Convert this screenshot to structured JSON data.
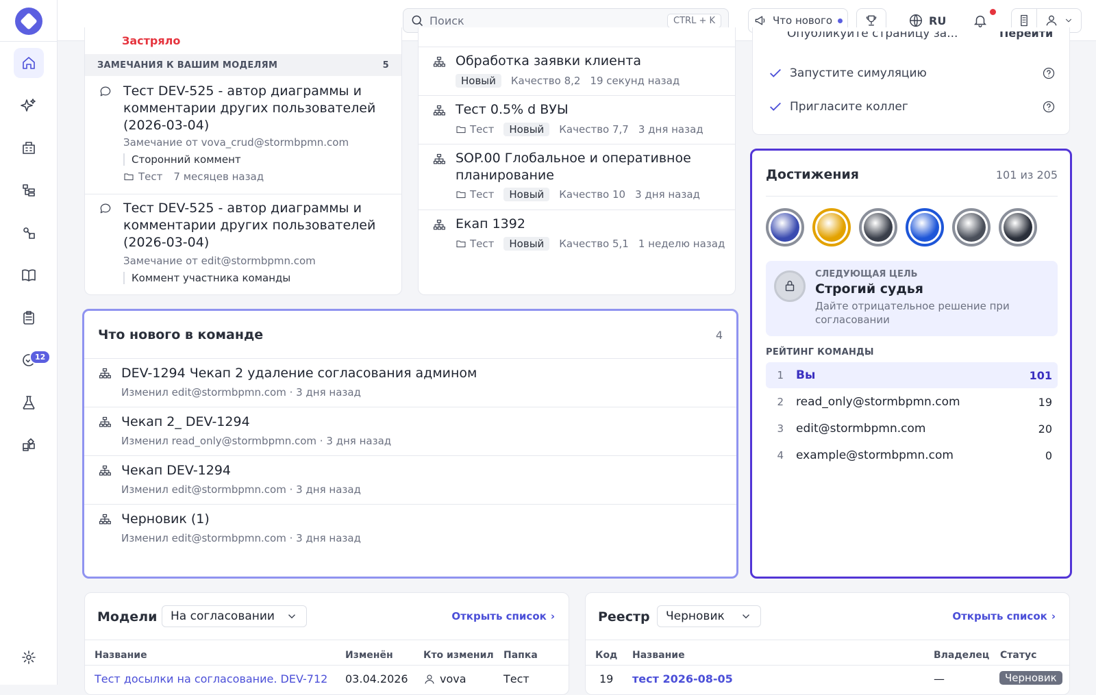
{
  "topbar": {
    "search_placeholder": "Поиск",
    "search_shortcut": "CTRL + K",
    "whats_new_label": "Что нового",
    "language": "RU"
  },
  "sidebar": {
    "badge_count": "12",
    "items": [
      "home-icon",
      "sparkles-icon",
      "building-icon",
      "hierarchy-icon",
      "shapes-icon",
      "book-icon",
      "clipboard-icon",
      "check-badge-icon",
      "flask-icon",
      "puzzle-icon"
    ]
  },
  "remarks": {
    "stuck_label": "Застряло",
    "header": "ЗАМЕЧАНИЯ К ВАШИМ МОДЕЛЯМ",
    "count": "5",
    "items": [
      {
        "title": "Тест DEV-525 - автор диаграммы и комментарии других пользователей (2026-03-04)",
        "from": "Замечание от vova_crud@stormbpmn.com",
        "quote": "Сторонний коммент",
        "folder": "Тест",
        "time": "7 месяцев назад"
      },
      {
        "title": "Тест DEV-525 - автор диаграммы и комментарии других пользователей (2026-03-04)",
        "from": "Замечание от edit@stormbpmn.com",
        "quote": "Коммент участника команды",
        "folder": "Тест",
        "time": "7 месяцев назад"
      }
    ]
  },
  "models_feed": {
    "items": [
      {
        "title": "Обработка заявки клиента",
        "folder": "",
        "status": "Новый",
        "quality": "Качество 8,2",
        "time": "19 секунд назад"
      },
      {
        "title": "Тест 0.5% d ВУЫ",
        "folder": "Тест",
        "status": "Новый",
        "quality": "Качество 7,7",
        "time": "3 дня назад"
      },
      {
        "title": "SOP.00 Глобальное и оперативное планирование",
        "folder": "Тест",
        "status": "Новый",
        "quality": "Качество 10",
        "time": "3 дня назад"
      },
      {
        "title": "Екап 1392",
        "folder": "Тест",
        "status": "Новый",
        "quality": "Качество 5,1",
        "time": "1 неделю назад"
      }
    ]
  },
  "onboarding": {
    "partial_item": "Опубликуйте страницу за...",
    "partial_action": "Перейти",
    "items": [
      "Запустите симуляцию",
      "Пригласите коллег"
    ]
  },
  "team_news": {
    "title": "Что нового в команде",
    "count": "4",
    "items": [
      {
        "title": "DEV-1294 Чекап 2 удаление согласования админом",
        "meta": "Изменил edit@stormbpmn.com · 3 дня назад"
      },
      {
        "title": "Чекап 2_ DEV-1294",
        "meta": "Изменил read_only@stormbpmn.com · 3 дня назад"
      },
      {
        "title": "Чекап DEV-1294",
        "meta": "Изменил edit@stormbpmn.com · 3 дня назад"
      },
      {
        "title": "Черновик (1)",
        "meta": "Изменил edit@stormbpmn.com · 3 дня назад"
      }
    ]
  },
  "achievements": {
    "title": "Достижения",
    "progress": "101 из 205",
    "next_goal_label": "СЛЕДУЮЩАЯ ЦЕЛЬ",
    "next_goal_title": "Строгий судья",
    "next_goal_desc": "Дайте отрицательное решение при согласовании",
    "rating_label": "РЕЙТИНГ КОМАНДЫ",
    "rating": [
      {
        "rank": "1",
        "name": "Вы",
        "score": "101"
      },
      {
        "rank": "2",
        "name": "read_only@stormbpmn.com",
        "score": "19"
      },
      {
        "rank": "3",
        "name": "edit@stormbpmn.com",
        "score": "20"
      },
      {
        "rank": "4",
        "name": "example@stormbpmn.com",
        "score": "0"
      }
    ],
    "badge_colors": [
      "#3a4bb0",
      "#e3a200",
      "#3a3f4a",
      "#1e56d8",
      "#4a4f5a",
      "#2a2f3a"
    ]
  },
  "models_table": {
    "title": "Модели",
    "filter": "На согласовании",
    "open_list": "Открыть список",
    "headers": [
      "Название",
      "Изменён",
      "Кто изменил",
      "Папка"
    ],
    "rows": [
      {
        "name": "Тест досылки на согласование. DEV-712",
        "date": "03.04.2026",
        "who": "vova",
        "folder": "Тест"
      }
    ]
  },
  "registry": {
    "title": "Реестр",
    "filter": "Черновик",
    "open_list": "Открыть список",
    "headers": [
      "Код",
      "Название",
      "Владелец",
      "Статус"
    ],
    "rows": [
      {
        "code": "19",
        "name": "тест 2026-08-05",
        "owner": "—",
        "status": "Черновик"
      }
    ]
  },
  "colors": {
    "accent": "#5b5fe0",
    "highlight_border": "#8f93f0",
    "achievement_border": "#5235d6",
    "danger": "#e5343e"
  }
}
